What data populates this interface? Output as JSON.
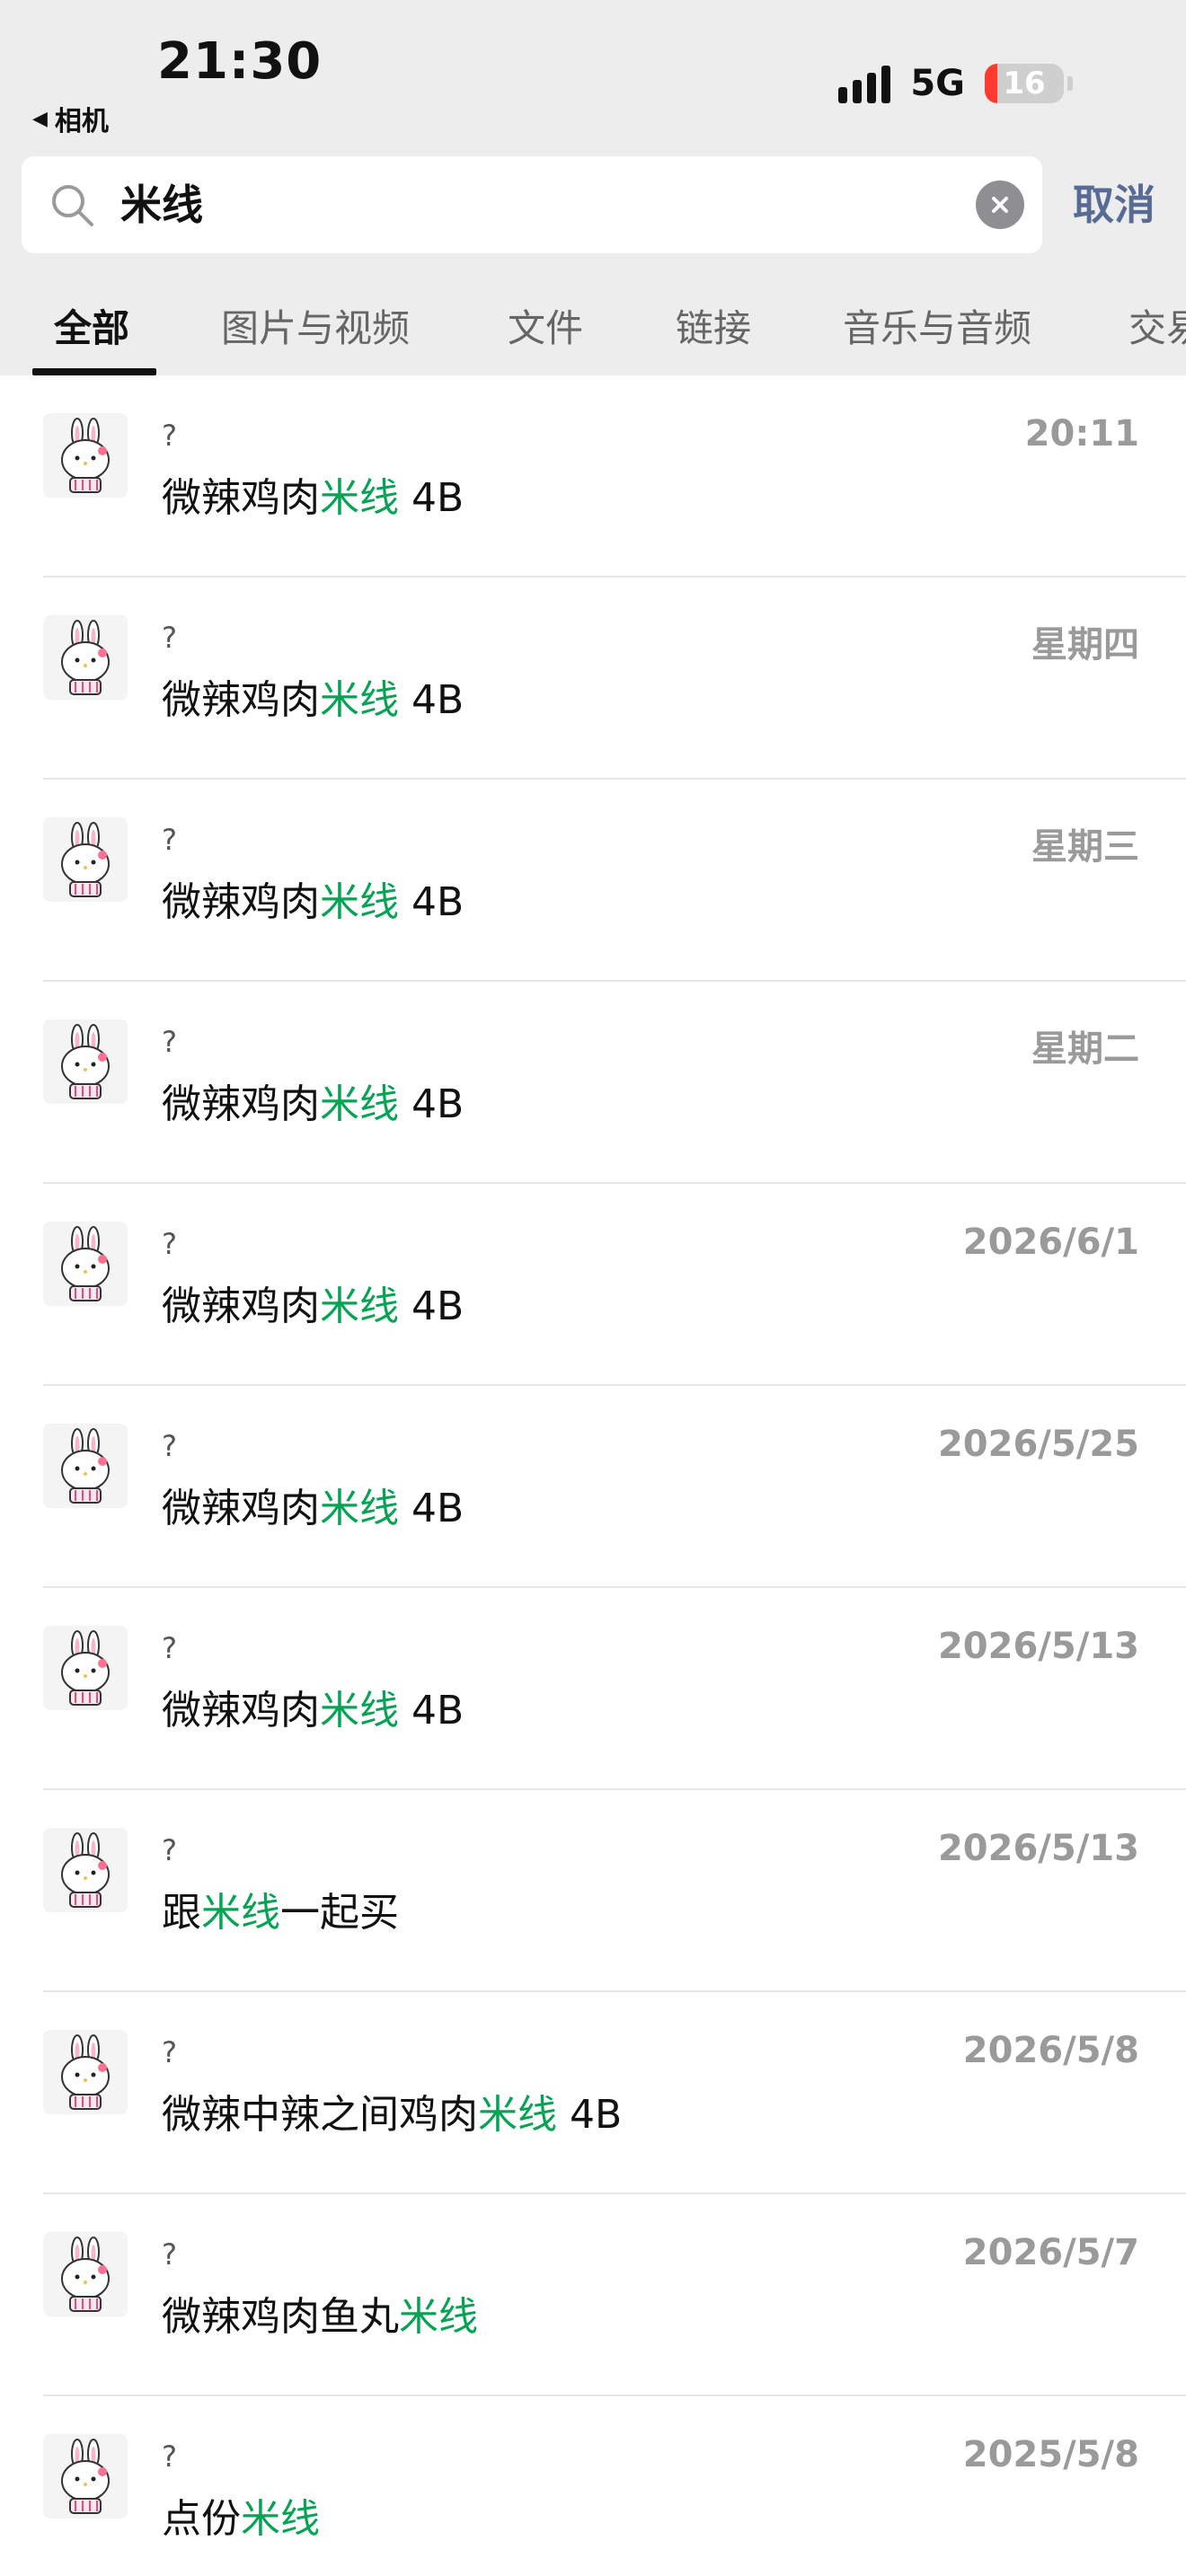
{
  "status_bar": {
    "time": "21:30",
    "back_app": "相机",
    "network": "5G",
    "battery_level": "16",
    "battery_fraction": 0.16,
    "battery_color": "#ff3b30"
  },
  "search": {
    "query": "米线",
    "cancel_label": "取消"
  },
  "tabs": [
    {
      "label": "全部",
      "active": true
    },
    {
      "label": "图片与视频",
      "active": false
    },
    {
      "label": "文件",
      "active": false
    },
    {
      "label": "链接",
      "active": false
    },
    {
      "label": "音乐与音频",
      "active": false
    },
    {
      "label": "交易",
      "active": false
    }
  ],
  "colors": {
    "highlight": "#07a354",
    "link": "#576b95",
    "header_bg": "#ededed"
  },
  "results": [
    {
      "sender": "?",
      "time": "20:11",
      "parts": [
        "微辣鸡肉",
        "米线",
        " 4B"
      ]
    },
    {
      "sender": "?",
      "time": "星期四",
      "parts": [
        "微辣鸡肉",
        "米线",
        " 4B"
      ]
    },
    {
      "sender": "?",
      "time": "星期三",
      "parts": [
        "微辣鸡肉",
        "米线",
        " 4B"
      ]
    },
    {
      "sender": "?",
      "time": "星期二",
      "parts": [
        "微辣鸡肉",
        "米线",
        " 4B"
      ]
    },
    {
      "sender": "?",
      "time": "2026/6/1",
      "parts": [
        "微辣鸡肉",
        "米线",
        " 4B"
      ]
    },
    {
      "sender": "?",
      "time": "2026/5/25",
      "parts": [
        "微辣鸡肉",
        "米线",
        " 4B"
      ]
    },
    {
      "sender": "?",
      "time": "2026/5/13",
      "parts": [
        "微辣鸡肉",
        "米线",
        " 4B"
      ]
    },
    {
      "sender": "?",
      "time": "2026/5/13",
      "parts": [
        "跟",
        "米线",
        "一起买"
      ]
    },
    {
      "sender": "?",
      "time": "2026/5/8",
      "parts": [
        "微辣中辣之间鸡肉",
        "米线",
        " 4B"
      ]
    },
    {
      "sender": "?",
      "time": "2026/5/7",
      "parts": [
        "微辣鸡肉鱼丸",
        "米线",
        ""
      ]
    },
    {
      "sender": "?",
      "time": "2025/5/8",
      "parts": [
        "点份",
        "米线",
        ""
      ]
    }
  ]
}
